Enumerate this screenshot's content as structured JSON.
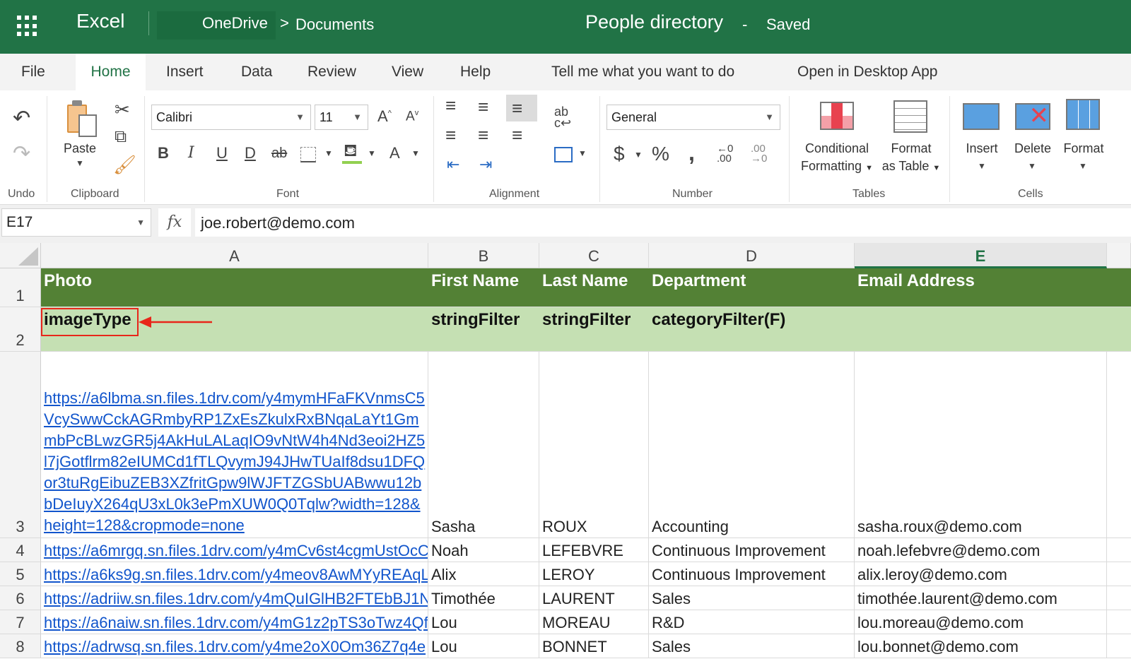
{
  "titlebar": {
    "app_name": "Excel",
    "location": "OneDrive",
    "chevron": ">",
    "folder": "Documents",
    "document_title": "People directory",
    "dash": "-",
    "save_status": "Saved"
  },
  "ribbon_tabs": [
    {
      "label": "File"
    },
    {
      "label": "Home",
      "active": true
    },
    {
      "label": "Insert"
    },
    {
      "label": "Data"
    },
    {
      "label": "Review"
    },
    {
      "label": "View"
    },
    {
      "label": "Help"
    },
    {
      "label": "Tell me what you want to do"
    },
    {
      "label": "Open in Desktop App"
    }
  ],
  "ribbon": {
    "groups": {
      "undo": "Undo",
      "clipboard": "Clipboard",
      "font": "Font",
      "alignment": "Alignment",
      "number": "Number",
      "tables": "Tables",
      "cells": "Cells"
    },
    "paste_label": "Paste",
    "font_name": "Calibri",
    "font_size": "11",
    "number_format": "General",
    "conditional_formatting": [
      "Conditional",
      "Formatting"
    ],
    "format_as_table": [
      "Format",
      "as Table"
    ],
    "insert_label": "Insert",
    "delete_label": "Delete",
    "format_label": "Format"
  },
  "formula_bar": {
    "name_box": "E17",
    "fx": "fx",
    "value": "joe.robert@demo.com"
  },
  "columns": [
    "A",
    "B",
    "C",
    "D",
    "E"
  ],
  "selected_column": "E",
  "rows": [
    {
      "num": "1",
      "cells": [
        "Photo",
        "First Name",
        "Last Name",
        "Department",
        "Email Address"
      ]
    },
    {
      "num": "2",
      "cells": [
        "imageType",
        "stringFilter",
        "stringFilter",
        "categoryFilter(F)",
        ""
      ]
    },
    {
      "num": "3",
      "cells": [
        "https://a6lbma.sn.files.1drv.com/y4mymHFaFKVnmsC5VcySwwCckAGRmbyRP1ZxEsZkulxRxBNqaLaYt1GmmbPcBLwzGR5j4AkHuLALaqIO9vNtW4h4Nd3eoi2HZ5l7jGotflrm82eIUMCd1fTLQvymJ94JHwTUaIf8dsu1DFQor3tuRgEibuZEB3XZfritGpw9lWJFTZGSbUABwwu12bbDeIuyX264qU3xL0k3ePmXUW0Q0Tqlw?width=128&height=128&cropmode=none",
        "Sasha",
        "ROUX",
        "Accounting",
        "sasha.roux@demo.com"
      ]
    },
    {
      "num": "4",
      "cells": [
        "https://a6mrgq.sn.files.1drv.com/y4mCv6st4cgmUstOcC",
        "Noah",
        "LEFEBVRE",
        "Continuous Improvement",
        "noah.lefebvre@demo.com"
      ]
    },
    {
      "num": "5",
      "cells": [
        "https://a6ks9g.sn.files.1drv.com/y4meov8AwMYyREAqL",
        "Alix",
        "LEROY",
        "Continuous Improvement",
        "alix.leroy@demo.com"
      ]
    },
    {
      "num": "6",
      "cells": [
        "https://adriiw.sn.files.1drv.com/y4mQuIGlHB2FTEbBJ1N",
        "Timothée",
        "LAURENT",
        "Sales",
        "timothée.laurent@demo.com"
      ]
    },
    {
      "num": "7",
      "cells": [
        "https://a6naiw.sn.files.1drv.com/y4mG1z2pTS3oTwz4Qf",
        "Lou",
        "MOREAU",
        "R&D",
        "lou.moreau@demo.com"
      ]
    },
    {
      "num": "8",
      "cells": [
        "https://adrwsq.sn.files.1drv.com/y4me2oX0Om36Z7q4e",
        "Lou",
        "BONNET",
        "Sales",
        "lou.bonnet@demo.com"
      ]
    }
  ],
  "colors": {
    "excel_green": "#217346",
    "header_row_bg": "#538135",
    "subheader_row_bg": "#c5e0b3",
    "link": "#1155cc",
    "annotation": "#e8261a"
  }
}
